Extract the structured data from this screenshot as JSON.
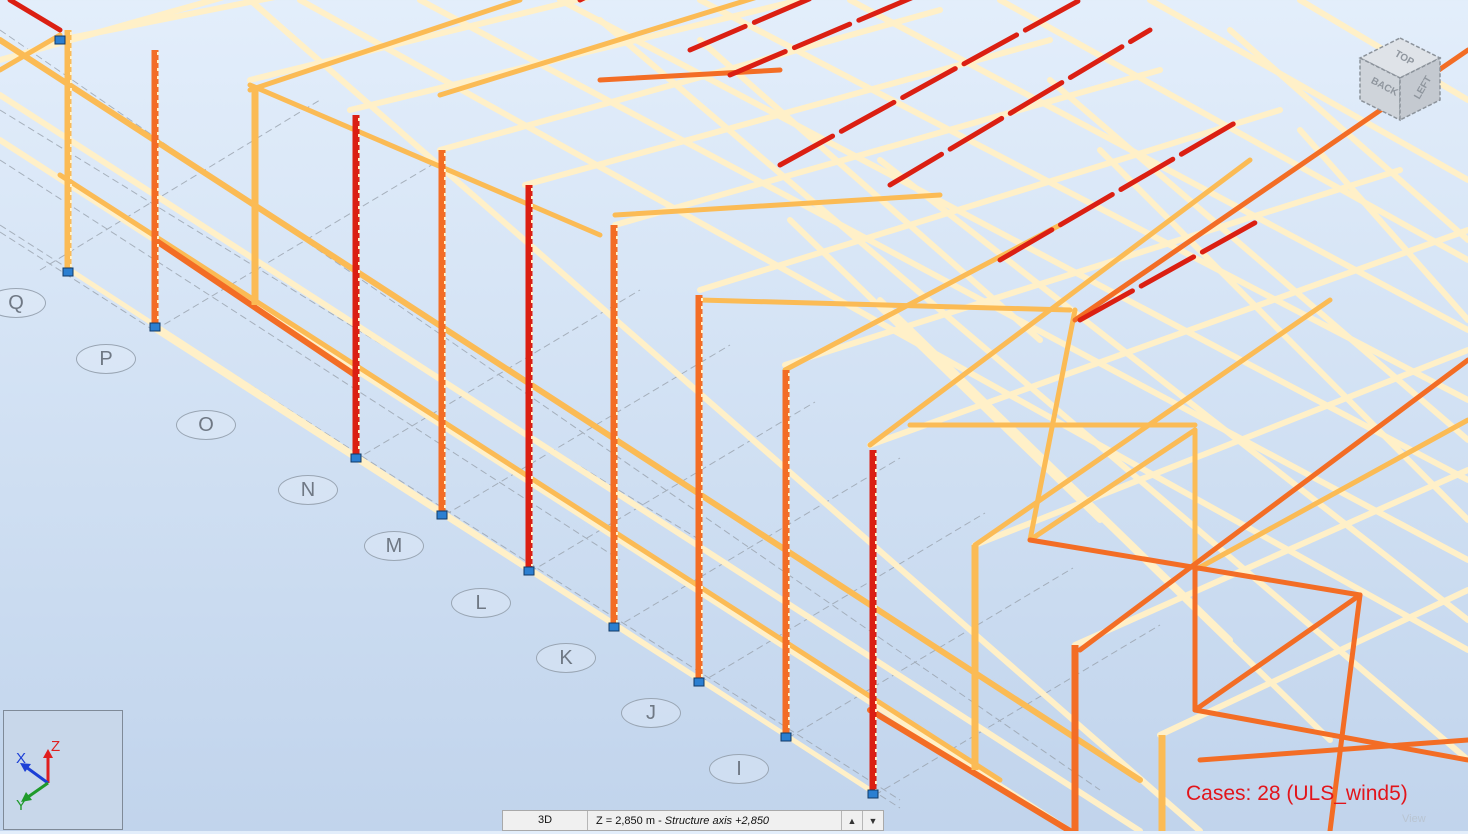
{
  "viewport": {
    "grid_labels": [
      "Q",
      "P",
      "O",
      "N",
      "M",
      "L",
      "K",
      "J",
      "I"
    ],
    "cases_label": "Cases: 28 (ULS_wind5)",
    "view_watermark": "View"
  },
  "view_cube": {
    "faces": [
      "TOP",
      "BACK",
      "LEFT"
    ]
  },
  "axis_triad": {
    "x_label": "X",
    "y_label": "Y",
    "z_label": "Z",
    "colors": {
      "x": "#1c3fd6",
      "y": "#1f9a2b",
      "z": "#e01e1e"
    }
  },
  "statusbar": {
    "view_mode": "3D",
    "level_value": "Z = 2,850 m",
    "level_separator": " - ",
    "level_axis": "Structure axis +2,850"
  },
  "colors": {
    "member_low": "#fff0c8",
    "member_mid": "#fbbb55",
    "member_high": "#f36d25",
    "member_max": "#db1f12",
    "cases_text": "#e2151b"
  }
}
